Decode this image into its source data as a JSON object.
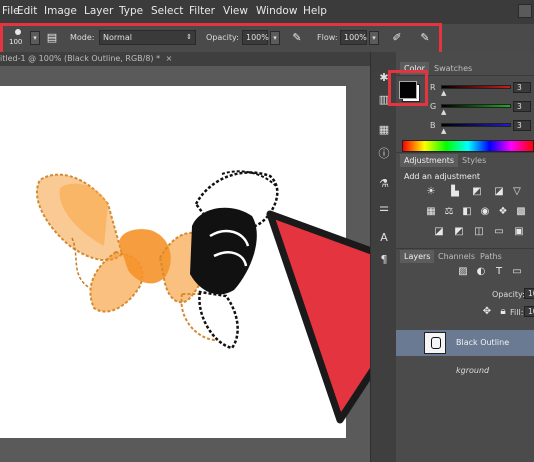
{
  "menu": [
    "File",
    "Edit",
    "Image",
    "Layer",
    "Type",
    "Select",
    "Filter",
    "View",
    "Window",
    "Help"
  ],
  "options_bar": {
    "brush_size": "100",
    "mode_label": "Mode:",
    "mode_value": "Normal",
    "opacity_label": "Opacity:",
    "opacity_value": "100%",
    "flow_label": "Flow:",
    "flow_value": "100%"
  },
  "document_tab": {
    "title": "itled-1 @ 100% (Black Outline, RGB/8) *",
    "close": "×"
  },
  "color_panel": {
    "tabs": [
      "Color",
      "Swatches"
    ],
    "sliders": [
      {
        "label": "R",
        "value": "3",
        "color": "#d11a1a"
      },
      {
        "label": "G",
        "value": "3",
        "color": "#1cae1c"
      },
      {
        "label": "B",
        "value": "3",
        "color": "#1b1bd6"
      }
    ],
    "foreground": "#030303",
    "background": "#ffffff"
  },
  "adjustments_panel": {
    "tabs": [
      "Adjustments",
      "Styles"
    ],
    "heading": "Add an adjustment",
    "icons_row1": [
      "brightness-icon",
      "levels-icon",
      "curves-icon",
      "exposure-icon",
      "vibrance-icon"
    ],
    "icons_row2": [
      "hue-saturation-icon",
      "color-balance-icon",
      "black-white-icon",
      "photo-filter-icon",
      "channel-mixer-icon",
      "color-lookup-icon"
    ],
    "icons_row3": [
      "invert-icon",
      "posterize-icon",
      "threshold-icon",
      "gradient-map-icon",
      "selective-color-icon"
    ]
  },
  "layers_panel": {
    "tabs": [
      "Layers",
      "Channels",
      "Paths"
    ],
    "opacity_label": "Opacity:",
    "opacity_value": "10",
    "fill_label": "Fill:",
    "fill_value": "10",
    "layers": [
      {
        "name": "Black Outline",
        "selected": true
      },
      {
        "name": "kground",
        "selected": false
      }
    ]
  },
  "highlight_color": "#e3343f",
  "brush_orange": "#f5962a"
}
